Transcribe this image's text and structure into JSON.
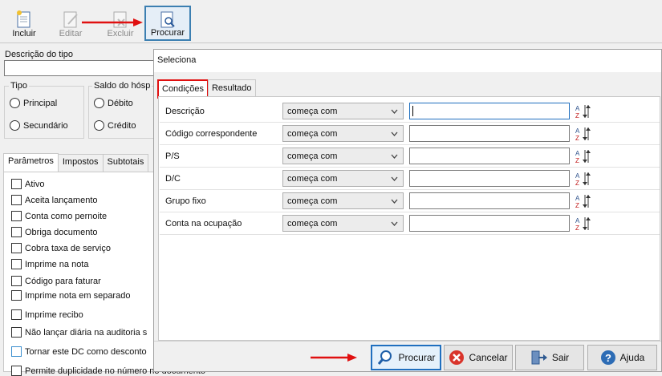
{
  "toolbar": {
    "buttons": [
      {
        "label": "Incluir",
        "icon": "new-document-icon",
        "enabled": true
      },
      {
        "label": "Editar",
        "icon": "edit-document-icon",
        "enabled": false
      },
      {
        "label": "Excluir",
        "icon": "delete-document-icon",
        "enabled": false
      },
      {
        "label": "Procurar",
        "icon": "search-document-icon",
        "enabled": true
      }
    ]
  },
  "form": {
    "descricao_label": "Descrição do tipo",
    "tipo": {
      "title": "Tipo",
      "options": [
        "Principal",
        "Secundário"
      ]
    },
    "saldo": {
      "title": "Saldo do hósp",
      "options": [
        "Débito",
        "Crédito"
      ]
    },
    "tabs": [
      "Parâmetros",
      "Impostos",
      "Subtotais"
    ],
    "checkboxes": [
      "Ativo",
      "Aceita lançamento",
      "Conta como pernoite",
      "Obriga documento",
      "Cobra taxa de serviço",
      "Imprime na nota",
      "Código para faturar",
      "Imprime nota em separado",
      "Imprime recibo",
      "Não lançar diária na auditoria s",
      "Tornar este DC como desconto",
      "Permite duplicidade no número no documento"
    ]
  },
  "dialog": {
    "title": "Seleciona",
    "tabs": [
      "Condições",
      "Resultado"
    ],
    "conditions": [
      {
        "field": "Descrição",
        "operator": "começa com",
        "value": ""
      },
      {
        "field": "Código correspondente",
        "operator": "começa com",
        "value": ""
      },
      {
        "field": "P/S",
        "operator": "começa com",
        "value": ""
      },
      {
        "field": "D/C",
        "operator": "começa com",
        "value": ""
      },
      {
        "field": "Grupo fixo",
        "operator": "começa com",
        "value": ""
      },
      {
        "field": "Conta na ocupação",
        "operator": "começa com",
        "value": ""
      }
    ],
    "buttons": {
      "procurar": "Procurar",
      "cancelar": "Cancelar",
      "sair": "Sair",
      "ajuda": "Ajuda"
    }
  },
  "colors": {
    "annotation_red": "#e01010",
    "accent_blue": "#1f6fbf"
  }
}
